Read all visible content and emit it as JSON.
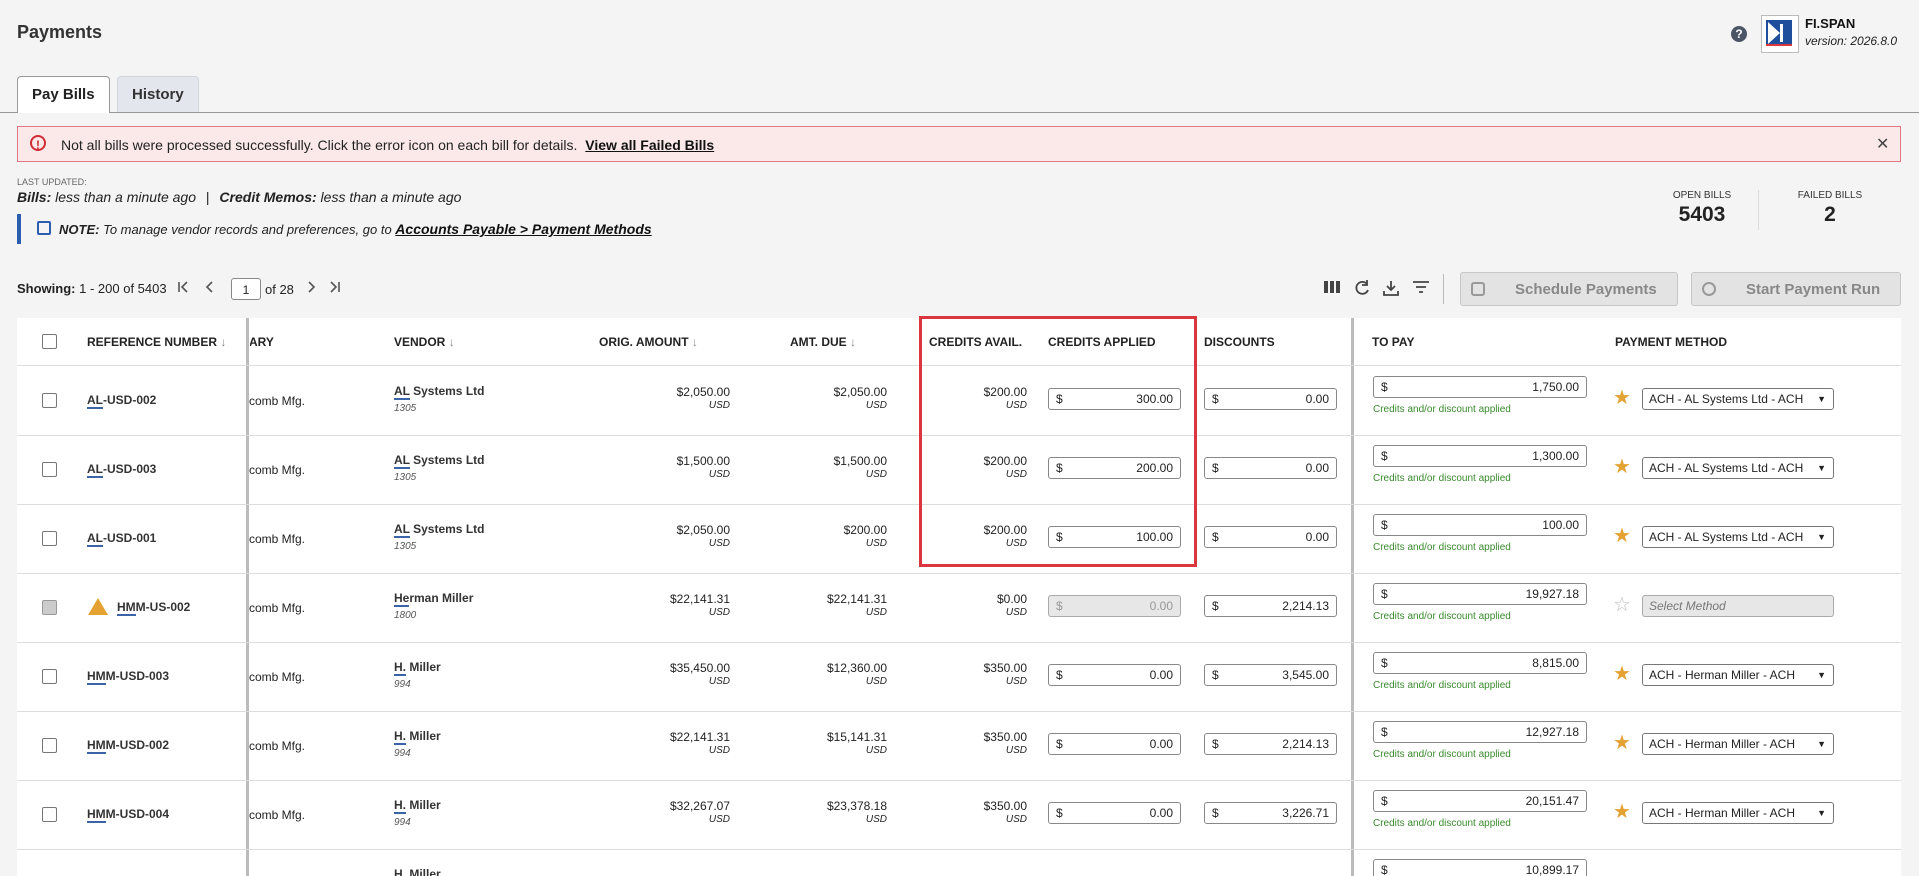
{
  "page": {
    "title": "Payments"
  },
  "brand": {
    "name": "FI.SPAN",
    "version": "version: 2026.8.0",
    "help_glyph": "?"
  },
  "tabs": [
    {
      "label": "Pay Bills"
    },
    {
      "label": "History"
    }
  ],
  "alert": {
    "icon_glyph": "!",
    "message": "Not all bills were processed successfully. Click the error icon on each bill for details.",
    "link": "View all Failed Bills",
    "close_glyph": "✕"
  },
  "last_updated": {
    "label": "LAST UPDATED:",
    "bills_label": "Bills:",
    "bills_value": "less than a minute ago",
    "sep": "|",
    "credits_label": "Credit Memos:",
    "credits_value": "less than a minute ago"
  },
  "note": {
    "prefix": "NOTE:",
    "text": "To manage vendor records and preferences, go to",
    "link": "Accounts Payable > Payment Methods"
  },
  "stats": {
    "open_label": "OPEN BILLS",
    "open_value": "5403",
    "failed_label": "FAILED BILLS",
    "failed_value": "2"
  },
  "pagination": {
    "showing_label": "Showing:",
    "range": "1 - 200 of 5403",
    "page": "1",
    "of": "of 28"
  },
  "toolbar": {
    "schedule_label": "Schedule Payments",
    "run_label": "Start Payment Run"
  },
  "columns": {
    "ref": "REFERENCE NUMBER",
    "diary": "DIARY",
    "vendor": "VENDOR",
    "orig": "ORIG. AMOUNT",
    "due": "AMT. DUE",
    "credits_avail": "CREDITS AVAIL.",
    "credits_applied": "CREDITS APPLIED",
    "discounts": "DISCOUNTS",
    "to_pay": "TO PAY",
    "method": "PAYMENT METHOD"
  },
  "currency_symbol": "$",
  "rows": [
    {
      "ref_pre": "AL",
      "ref_rest": "-USD-002",
      "diary": "comb Mfg.",
      "vendor_pre": "AL",
      "vendor_rest": " Systems Ltd",
      "vendor_no": "1305",
      "orig": "$2,050.00",
      "orig_cur": "USD",
      "due": "$2,050.00",
      "due_cur": "USD",
      "credits": "$200.00",
      "credits_cur": "USD",
      "applied": "300.00",
      "discount": "0.00",
      "to_pay": "1,750.00",
      "note": "Credits and/or discount applied",
      "method": "ACH - AL Systems Ltd - ACH"
    },
    {
      "ref_pre": "AL",
      "ref_rest": "-USD-003",
      "diary": "comb Mfg.",
      "vendor_pre": "AL",
      "vendor_rest": " Systems Ltd",
      "vendor_no": "1305",
      "orig": "$1,500.00",
      "orig_cur": "USD",
      "due": "$1,500.00",
      "due_cur": "USD",
      "credits": "$200.00",
      "credits_cur": "USD",
      "applied": "200.00",
      "discount": "0.00",
      "to_pay": "1,300.00",
      "note": "Credits and/or discount applied",
      "method": "ACH - AL Systems Ltd - ACH"
    },
    {
      "ref_pre": "AL",
      "ref_rest": "-USD-001",
      "diary": "comb Mfg.",
      "vendor_pre": "AL",
      "vendor_rest": " Systems Ltd",
      "vendor_no": "1305",
      "orig": "$2,050.00",
      "orig_cur": "USD",
      "due": "$200.00",
      "due_cur": "USD",
      "credits": "$200.00",
      "credits_cur": "USD",
      "applied": "100.00",
      "discount": "0.00",
      "to_pay": "100.00",
      "note": "Credits and/or discount applied",
      "method": "ACH - AL Systems Ltd - ACH"
    },
    {
      "ref_pre": "HM",
      "ref_rest": "M-US-002",
      "diary": "comb Mfg.",
      "vendor_pre": "He",
      "vendor_rest": "rman Miller",
      "vendor_no": "1800",
      "orig": "$22,141.31",
      "orig_cur": "USD",
      "due": "$22,141.31",
      "due_cur": "USD",
      "credits": "$0.00",
      "credits_cur": "USD",
      "applied": "0.00",
      "discount": "2,214.13",
      "to_pay": "19,927.18",
      "note": "Credits and/or discount applied",
      "method": "Select Method"
    },
    {
      "ref_pre": "HM",
      "ref_rest": "M-USD-003",
      "diary": "comb Mfg.",
      "vendor_pre": "H.",
      "vendor_rest": " Miller",
      "vendor_no": "994",
      "orig": "$35,450.00",
      "orig_cur": "USD",
      "due": "$12,360.00",
      "due_cur": "USD",
      "credits": "$350.00",
      "credits_cur": "USD",
      "applied": "0.00",
      "discount": "3,545.00",
      "to_pay": "8,815.00",
      "note": "Credits and/or discount applied",
      "method": "ACH - Herman Miller - ACH"
    },
    {
      "ref_pre": "HM",
      "ref_rest": "M-USD-002",
      "diary": "comb Mfg.",
      "vendor_pre": "H.",
      "vendor_rest": " Miller",
      "vendor_no": "994",
      "orig": "$22,141.31",
      "orig_cur": "USD",
      "due": "$15,141.31",
      "due_cur": "USD",
      "credits": "$350.00",
      "credits_cur": "USD",
      "applied": "0.00",
      "discount": "2,214.13",
      "to_pay": "12,927.18",
      "note": "Credits and/or discount applied",
      "method": "ACH - Herman Miller - ACH"
    },
    {
      "ref_pre": "HM",
      "ref_rest": "M-USD-004",
      "diary": "comb Mfg.",
      "vendor_pre": "H.",
      "vendor_rest": " Miller",
      "vendor_no": "994",
      "orig": "$32,267.07",
      "orig_cur": "USD",
      "due": "$23,378.18",
      "due_cur": "USD",
      "credits": "$350.00",
      "credits_cur": "USD",
      "applied": "0.00",
      "discount": "3,226.71",
      "to_pay": "20,151.47",
      "note": "Credits and/or discount applied",
      "method": "ACH - Herman Miller - ACH"
    },
    {
      "vendor_pre": "H.",
      "vendor_rest": " Miller",
      "to_pay": "10,899.17"
    }
  ]
}
